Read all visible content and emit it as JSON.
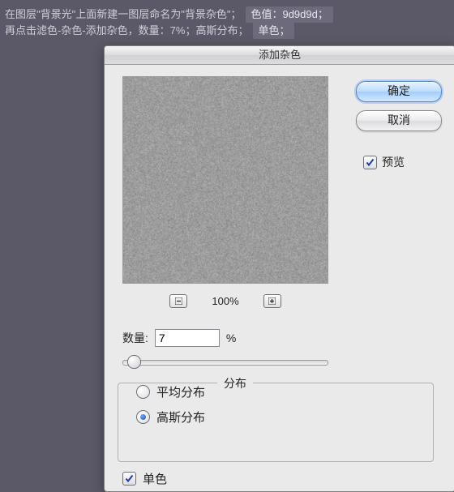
{
  "instructions": {
    "line1_main": "在图层\"背景光\"上面新建一图层命名为\"背景杂色\"；",
    "line1_chip": "色值：9d9d9d；",
    "line2_main": "再点击滤色-杂色-添加杂色，数量：7%；高斯分布；",
    "line2_chip": "单色；"
  },
  "dialog": {
    "title": "添加杂色",
    "buttons": {
      "ok": "确定",
      "cancel": "取消"
    },
    "preview_label": "预览",
    "preview_checked": true,
    "zoom": {
      "value": "100%"
    },
    "amount": {
      "label": "数量:",
      "value": "7",
      "unit": "%"
    },
    "distribution": {
      "legend": "分布",
      "uniform": "平均分布",
      "gaussian": "高斯分布",
      "selected": "gaussian"
    },
    "monochrome": {
      "label": "单色",
      "checked": true
    }
  }
}
